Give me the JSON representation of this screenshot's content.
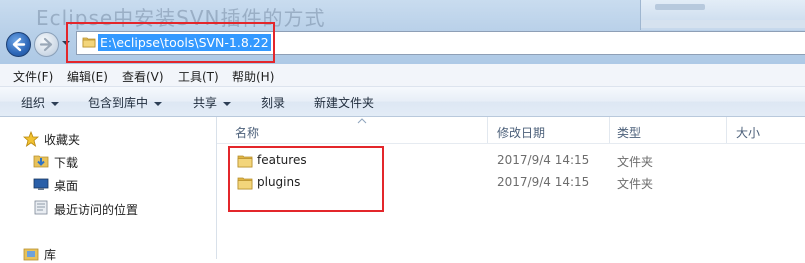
{
  "window": {
    "background_title": "Eclipse中安装SVN插件的方式"
  },
  "address": {
    "path": "E:\\eclipse\\tools\\SVN-1.8.22"
  },
  "menu": [
    "文件(F)",
    "编辑(E)",
    "查看(V)",
    "工具(T)",
    "帮助(H)"
  ],
  "toolbar": {
    "organize": "组织",
    "include_in_library": "包含到库中",
    "share": "共享",
    "burn": "刻录",
    "new_folder": "新建文件夹"
  },
  "navigation": {
    "favorites": "收藏夹",
    "downloads": "下载",
    "desktop": "桌面",
    "recent_places": "最近访问的位置",
    "libraries": "库"
  },
  "columns": {
    "name": "名称",
    "date_modified": "修改日期",
    "type": "类型",
    "size": "大小"
  },
  "files": [
    {
      "name": "features",
      "date": "2017/9/4 14:15",
      "type": "文件夹"
    },
    {
      "name": "plugins",
      "date": "2017/9/4 14:15",
      "type": "文件夹"
    }
  ],
  "colors": {
    "highlight_border": "#e3262b",
    "selection": "#3399ff",
    "folder": "#e8c25a"
  }
}
